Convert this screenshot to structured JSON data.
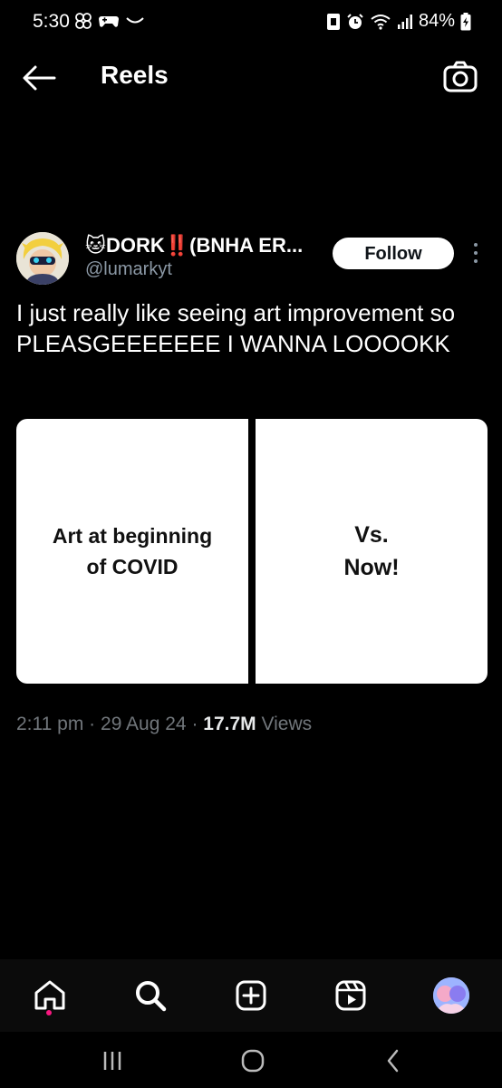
{
  "status_bar": {
    "time": "5:30",
    "battery": "84%"
  },
  "header": {
    "title": "Reels",
    "back_icon": "arrow-left-icon",
    "camera_icon": "camera-icon"
  },
  "post": {
    "author": {
      "emoji": "🐱",
      "name_part1": "DORK",
      "name_emoji": "‼️",
      "name_part2": "(BNHA ER...",
      "handle": "@lumarkyt"
    },
    "follow_label": "Follow",
    "text": "I just really like seeing art improvement so PLEASGEEEEEEE I WANNA LOOOOKK",
    "media": {
      "left_caption": "Art at beginning\nof COVID",
      "right_caption": "Vs.\nNow!"
    },
    "meta": {
      "time": "2:11 pm",
      "separator": "·",
      "date": "29 Aug 24",
      "views_count": "17.7M",
      "views_label": "Views"
    }
  },
  "bottom_nav": {
    "items": [
      {
        "name": "home",
        "icon": "home-icon"
      },
      {
        "name": "search",
        "icon": "search-icon"
      },
      {
        "name": "compose",
        "icon": "plus-square-icon"
      },
      {
        "name": "reels",
        "icon": "reels-icon"
      },
      {
        "name": "profile",
        "icon": "profile-avatar"
      }
    ]
  },
  "colors": {
    "background": "#000000",
    "follow_bg": "#ffffff",
    "secondary_text": "#71767b",
    "handle_text": "#8b98a5",
    "notification_dot": "#f91880"
  }
}
